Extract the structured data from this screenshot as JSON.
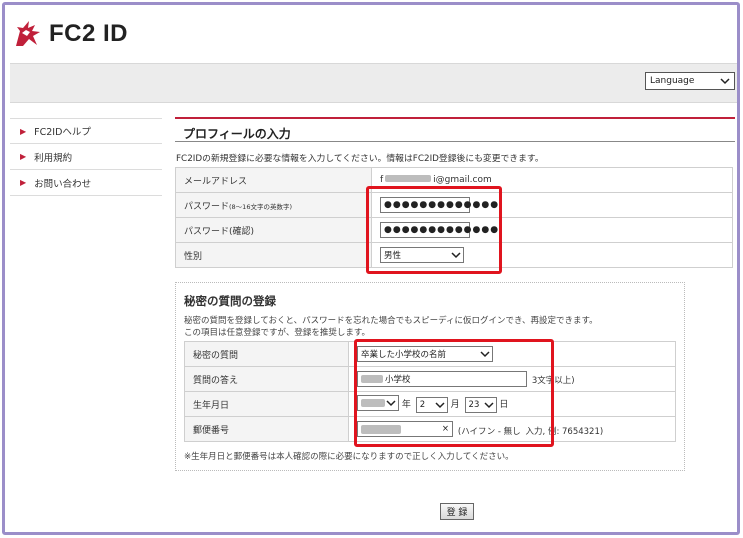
{
  "header": {
    "logo_text": "FC2 ID",
    "language_select": "Language"
  },
  "sidebar": {
    "items": [
      {
        "label": "FC2IDヘルプ"
      },
      {
        "label": "利用規約"
      },
      {
        "label": "お問い合わせ"
      }
    ]
  },
  "main": {
    "title": "プロフィールの入力",
    "intro": "FC2IDの新規登録に必要な情報を入力してください。情報はFC2ID登録後にも変更できます。",
    "rows": {
      "email_label": "メールアドレス",
      "email_prefix": "f",
      "email_value": "i@gmail.com",
      "password_label": "パスワード",
      "password_note": "(8～16文字の英数字)",
      "password_value": "●●●●●●●●●●●●●",
      "password_confirm_label": "パスワード(確認)",
      "password_confirm_value": "●●●●●●●●●●●●●",
      "gender_label": "性別",
      "gender_value": "男性"
    }
  },
  "secret": {
    "title": "秘密の質問の登録",
    "note_line1": "秘密の質問を登録しておくと、パスワードを忘れた場合でもスピーディに仮ログインでき、再設定できます。",
    "note_line2": "この項目は任意登録ですが、登録を推奨します。",
    "question_label": "秘密の質問",
    "question_value": "卒業した小学校の名前",
    "answer_label": "質問の答え",
    "answer_value": "小学校",
    "answer_hint": "3文字以上)",
    "birth_label": "生年月日",
    "birth_year_unit": "年",
    "birth_month": "2",
    "birth_month_unit": "月",
    "birth_day": "23",
    "birth_day_unit": "日",
    "zip_label": "郵便番号",
    "zip_clear": "×",
    "zip_hint_a": "(ハイフン - 無し",
    "zip_hint_b": "入力, 例: 7654321)",
    "footnote": "※生年月日と郵便番号は本人確認の際に必要になりますので正しく入力してください。"
  },
  "submit_label": "登 録",
  "colors": {
    "accent": "#c0203a",
    "highlight": "#e0141e",
    "frame": "#9b8ec9"
  }
}
